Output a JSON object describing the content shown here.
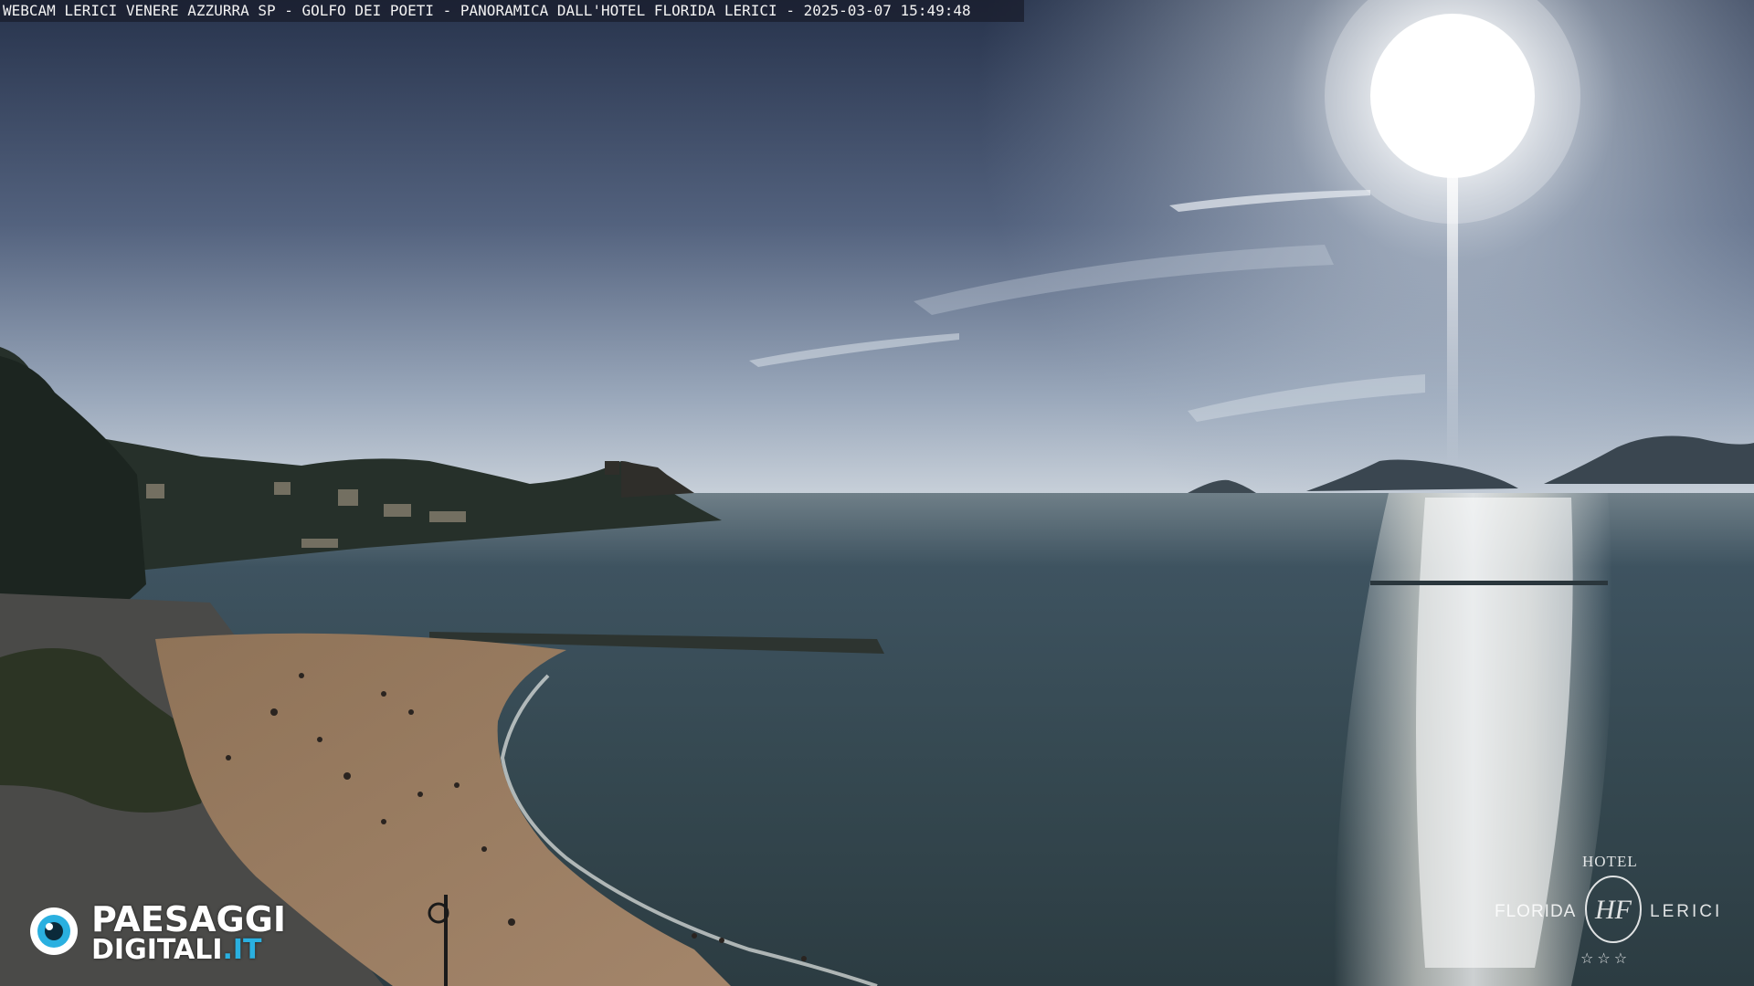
{
  "overlay": {
    "caption": "WEBCAM LERICI VENERE AZZURRA SP - GOLFO DEI POETI - PANORAMICA DALL'HOTEL FLORIDA LERICI - 2025-03-07 15:49:48"
  },
  "watermark_left": {
    "word1": "PAESAGGI",
    "word2": "DIGITALI",
    "tld": ".IT",
    "icon": "eye-logo-icon",
    "accent_color": "#2ab0e0"
  },
  "watermark_right": {
    "hotel": "HOTEL",
    "name": "FLORIDA",
    "town": "LERICI",
    "monogram": "HF",
    "stars": "☆☆☆"
  },
  "colors": {
    "sky_top": "#2a3650",
    "sky_horizon": "#c8d2dc",
    "sea": "#3a4c56",
    "sand": "#9a7a58"
  }
}
